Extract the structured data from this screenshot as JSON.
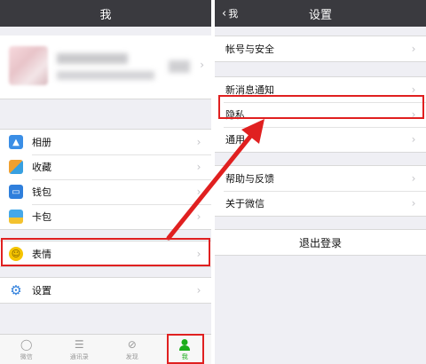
{
  "left": {
    "title": "我",
    "items_group1": [
      {
        "label": "相册",
        "icon": "photo-album-icon",
        "color": "#3a8ee6"
      },
      {
        "label": "收藏",
        "icon": "favorites-cube-icon",
        "color": "#f0a030"
      },
      {
        "label": "钱包",
        "icon": "wallet-icon",
        "color": "#2f7fdc"
      },
      {
        "label": "卡包",
        "icon": "card-pack-icon",
        "color": "#46a8e8"
      }
    ],
    "items_group2": [
      {
        "label": "表情",
        "icon": "emoji-icon",
        "color": "#f5c400"
      }
    ],
    "items_group3": [
      {
        "label": "设置",
        "icon": "gear-icon",
        "color": "#2f7fdc"
      }
    ],
    "tabs": [
      {
        "label": "微信",
        "icon": "chat-bubble-icon"
      },
      {
        "label": "通讯录",
        "icon": "contacts-icon"
      },
      {
        "label": "发现",
        "icon": "compass-icon"
      },
      {
        "label": "我",
        "icon": "person-icon",
        "active": true
      }
    ]
  },
  "right": {
    "title": "设置",
    "back_label": "我",
    "items_group1": [
      {
        "label": "帐号与安全"
      }
    ],
    "items_group2": [
      {
        "label": "新消息通知"
      },
      {
        "label": "隐私"
      },
      {
        "label": "通用"
      }
    ],
    "items_group3": [
      {
        "label": "帮助与反馈"
      },
      {
        "label": "关于微信"
      }
    ],
    "logout_label": "退出登录"
  },
  "colors": {
    "navbar": "#3a3a3f",
    "highlight": "#e02020",
    "active_tab": "#1aad19"
  }
}
